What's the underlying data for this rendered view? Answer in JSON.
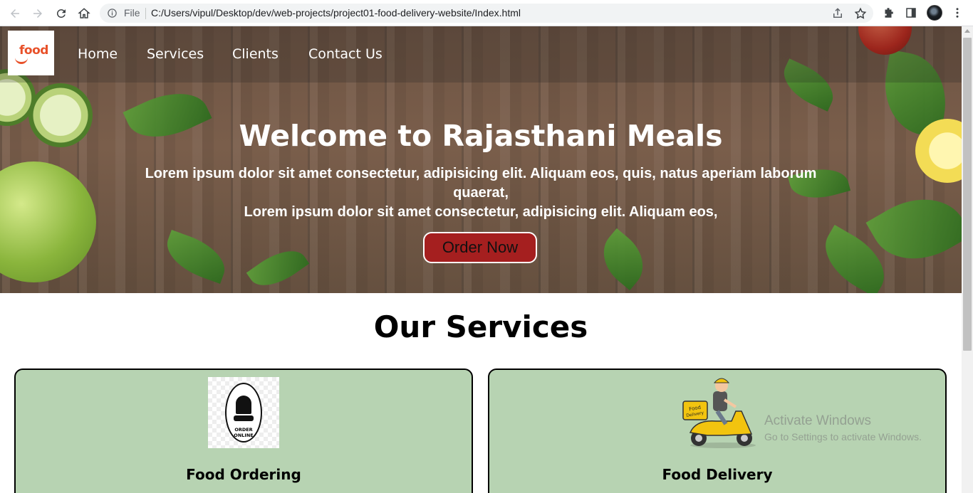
{
  "browser": {
    "file_label": "File",
    "url": "C:/Users/vipul/Desktop/dev/web-projects/project01-food-delivery-website/Index.html"
  },
  "logo": {
    "text": "food"
  },
  "nav": {
    "items": [
      {
        "label": "Home"
      },
      {
        "label": "Services"
      },
      {
        "label": "Clients"
      },
      {
        "label": "Contact Us"
      }
    ]
  },
  "hero": {
    "title": "Welcome to Rajasthani Meals",
    "line1": "Lorem ipsum dolor sit amet consectetur, adipisicing elit. Aliquam eos, quis, natus aperiam laborum quaerat,",
    "line2": "Lorem ipsum dolor sit amet consectetur, adipisicing elit. Aliquam eos,",
    "cta_label": "Order Now"
  },
  "services": {
    "title": "Our Services",
    "cards": [
      {
        "title": "Food Ordering",
        "image_label": "ORDER ONLINE"
      },
      {
        "title": "Food Delivery",
        "image_label": "Food Delivery"
      }
    ]
  },
  "watermark": {
    "title": "Activate Windows",
    "subtitle": "Go to Settings to activate Windows."
  },
  "colors": {
    "accent": "#a51f1f",
    "card_bg": "#b7d3b2",
    "logo": "#e8512a"
  }
}
